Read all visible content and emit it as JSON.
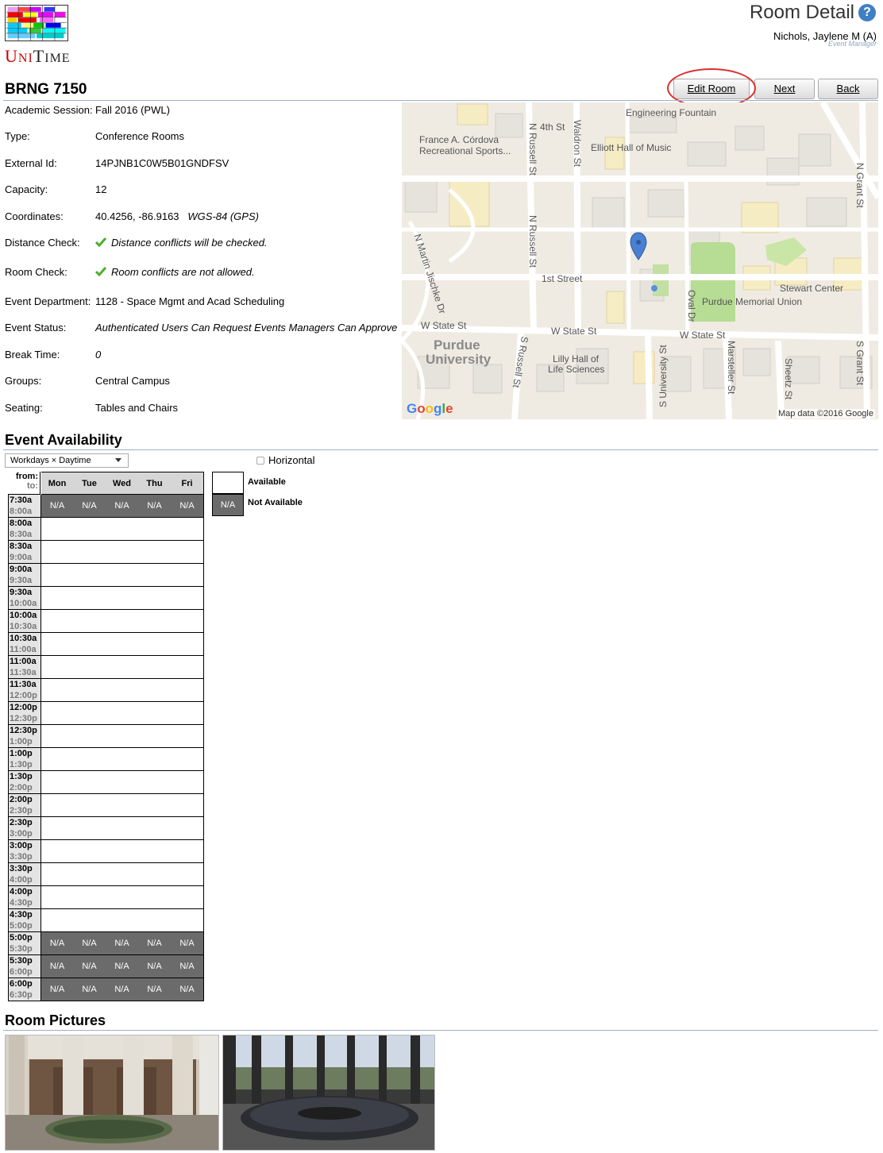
{
  "header": {
    "logo_text_first": "U",
    "logo_text_rest": "NI",
    "logo_text_second": "T",
    "logo_text_second_rest": "IME",
    "page_title": "Room Detail",
    "help_label": "?",
    "user_name": "Nichols, Jaylene M (A)",
    "user_role": "Event Manager"
  },
  "room": {
    "title": "BRNG 7150"
  },
  "buttons": {
    "edit": "Edit Room",
    "next": "Next",
    "back": "Back"
  },
  "properties": [
    {
      "label": "Academic Session:",
      "value": "Fall 2016 (PWL)"
    },
    {
      "label": "Type:",
      "value": "Conference Rooms"
    },
    {
      "label": "External Id:",
      "value": "14PJNB1C0W5B01GNDFSV"
    },
    {
      "label": "Capacity:",
      "value": "12"
    },
    {
      "label": "Coordinates:",
      "value": "40.4256, -86.9163",
      "extra": "WGS-84 (GPS)"
    },
    {
      "label": "Distance Check:",
      "value": "Distance conflicts will be checked."
    },
    {
      "label": "Room Check:",
      "value": "Room conflicts are not allowed."
    },
    {
      "label": "Event Department:",
      "value": "1128 - Space Mgmt and Acad Scheduling"
    },
    {
      "label": "Event Status:",
      "value": "Authenticated Users Can Request Events Managers Can Approve"
    },
    {
      "label": "Break Time:",
      "value": "0"
    },
    {
      "label": "Groups:",
      "value": "Central Campus"
    },
    {
      "label": "Seating:",
      "value": "Tables and Chairs"
    }
  ],
  "map": {
    "labels": {
      "engineering_fountain": "Engineering Fountain",
      "fourth_st": "4th St",
      "cordova_1": "France A. Córdova",
      "cordova_2": "Recreational Sports...",
      "n_russell_1": "N Russell St",
      "waldron": "Waldron St",
      "elliott": "Elliott Hall of Music",
      "n_grant": "N Grant St",
      "n_russell_2": "N Russell St",
      "n_martin": "N Martin Jischke Dr",
      "first_street": "1st Street",
      "stewart": "Stewart Center",
      "oval_dr": "Oval Dr",
      "memorial_union": "Purdue Memorial Union",
      "w_state_1": "W State St",
      "w_state_2": "W State St",
      "w_state_3": "W State St",
      "purdue_1": "Purdue",
      "purdue_2": "University",
      "s_russell": "S Russell St",
      "lilly_1": "Lilly Hall of",
      "lilly_2": "Life Sciences",
      "s_university": "S University St",
      "marsteller": "Marsteller St",
      "sheetz": "Sheetz St",
      "s_grant": "S Grant St"
    },
    "google": "Google",
    "credit": "Map data ©2016 Google"
  },
  "availability": {
    "title": "Event Availability",
    "mode": "Workdays × Daytime",
    "horizontal_label": "Horizontal",
    "from_label": "from:",
    "to_label": "to:",
    "days": [
      "Mon",
      "Tue",
      "Wed",
      "Thu",
      "Fri"
    ],
    "na_text": "N/A",
    "slots": [
      {
        "from": "7:30a",
        "to": "8:00a",
        "available": false
      },
      {
        "from": "8:00a",
        "to": "8:30a",
        "available": true
      },
      {
        "from": "8:30a",
        "to": "9:00a",
        "available": true
      },
      {
        "from": "9:00a",
        "to": "9:30a",
        "available": true
      },
      {
        "from": "9:30a",
        "to": "10:00a",
        "available": true
      },
      {
        "from": "10:00a",
        "to": "10:30a",
        "available": true
      },
      {
        "from": "10:30a",
        "to": "11:00a",
        "available": true
      },
      {
        "from": "11:00a",
        "to": "11:30a",
        "available": true
      },
      {
        "from": "11:30a",
        "to": "12:00p",
        "available": true
      },
      {
        "from": "12:00p",
        "to": "12:30p",
        "available": true
      },
      {
        "from": "12:30p",
        "to": "1:00p",
        "available": true
      },
      {
        "from": "1:00p",
        "to": "1:30p",
        "available": true
      },
      {
        "from": "1:30p",
        "to": "2:00p",
        "available": true
      },
      {
        "from": "2:00p",
        "to": "2:30p",
        "available": true
      },
      {
        "from": "2:30p",
        "to": "3:00p",
        "available": true
      },
      {
        "from": "3:00p",
        "to": "3:30p",
        "available": true
      },
      {
        "from": "3:30p",
        "to": "4:00p",
        "available": true
      },
      {
        "from": "4:00p",
        "to": "4:30p",
        "available": true
      },
      {
        "from": "4:30p",
        "to": "5:00p",
        "available": true
      },
      {
        "from": "5:00p",
        "to": "5:30p",
        "available": false
      },
      {
        "from": "5:30p",
        "to": "6:00p",
        "available": false
      },
      {
        "from": "6:00p",
        "to": "6:30p",
        "available": false
      }
    ],
    "legend": {
      "available": "Available",
      "not_available": "Not Available"
    }
  },
  "pictures": {
    "title": "Room Pictures"
  },
  "colors": {
    "accent_line": "#9cb0ce",
    "not_available": "#6b6b6b",
    "highlight_ring": "#d9302a",
    "help_icon": "#3f7fc4"
  }
}
